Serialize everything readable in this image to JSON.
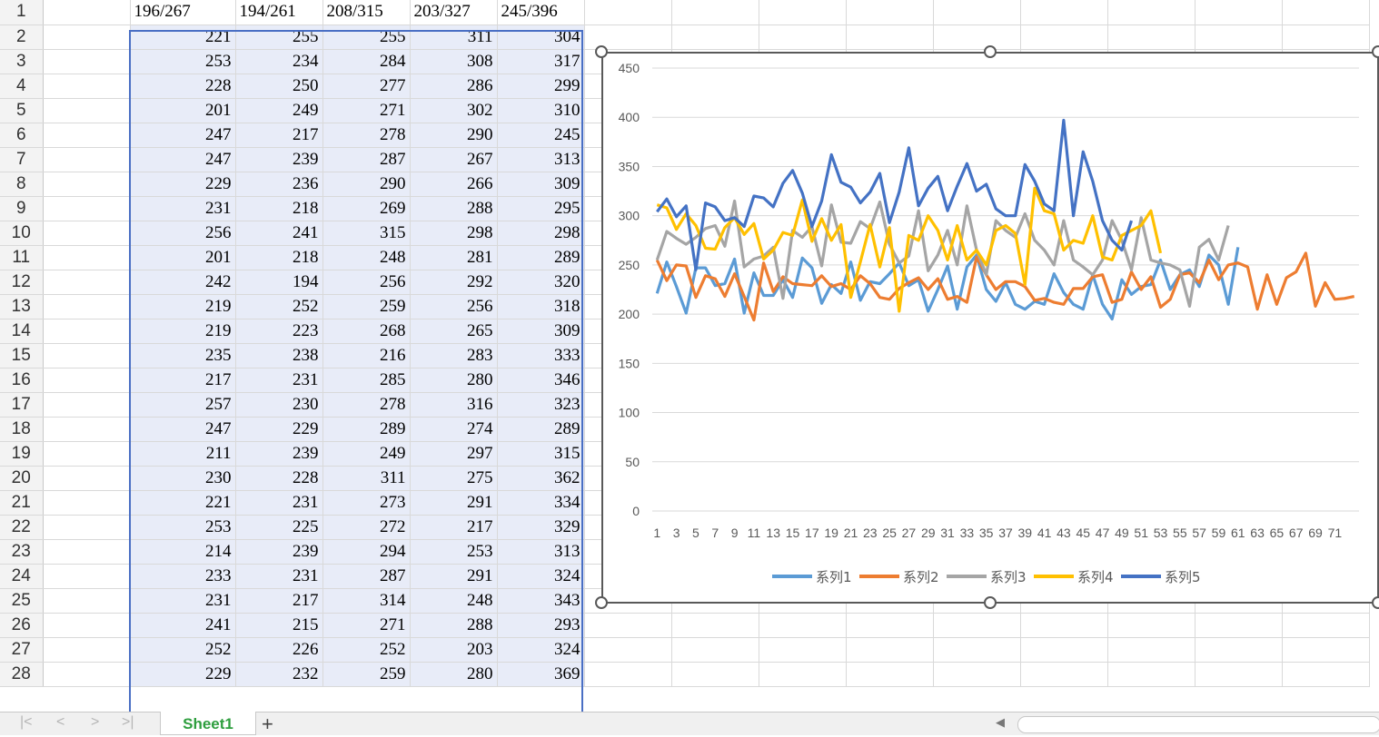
{
  "sheet": {
    "col_headers": [
      "196/267",
      "194/261",
      "208/315",
      "203/327",
      "245/396"
    ],
    "row_numbers": [
      "1",
      "2",
      "3",
      "4",
      "5",
      "6",
      "7",
      "8",
      "9",
      "10",
      "11",
      "12",
      "13",
      "14",
      "15",
      "16",
      "17",
      "18",
      "19",
      "20",
      "21",
      "22",
      "23",
      "24",
      "25",
      "26",
      "27",
      "28"
    ],
    "rows": [
      [
        "221",
        "255",
        "255",
        "311",
        "304"
      ],
      [
        "253",
        "234",
        "284",
        "308",
        "317"
      ],
      [
        "228",
        "250",
        "277",
        "286",
        "299"
      ],
      [
        "201",
        "249",
        "271",
        "302",
        "310"
      ],
      [
        "247",
        "217",
        "278",
        "290",
        "245"
      ],
      [
        "247",
        "239",
        "287",
        "267",
        "313"
      ],
      [
        "229",
        "236",
        "290",
        "266",
        "309"
      ],
      [
        "231",
        "218",
        "269",
        "288",
        "295"
      ],
      [
        "256",
        "241",
        "315",
        "298",
        "298"
      ],
      [
        "201",
        "218",
        "248",
        "281",
        "289"
      ],
      [
        "242",
        "194",
        "256",
        "292",
        "320"
      ],
      [
        "219",
        "252",
        "259",
        "256",
        "318"
      ],
      [
        "219",
        "223",
        "268",
        "265",
        "309"
      ],
      [
        "235",
        "238",
        "216",
        "283",
        "333"
      ],
      [
        "217",
        "231",
        "285",
        "280",
        "346"
      ],
      [
        "257",
        "230",
        "278",
        "316",
        "323"
      ],
      [
        "247",
        "229",
        "289",
        "274",
        "289"
      ],
      [
        "211",
        "239",
        "249",
        "297",
        "315"
      ],
      [
        "230",
        "228",
        "311",
        "275",
        "362"
      ],
      [
        "221",
        "231",
        "273",
        "291",
        "334"
      ],
      [
        "253",
        "225",
        "272",
        "217",
        "329"
      ],
      [
        "214",
        "239",
        "294",
        "253",
        "313"
      ],
      [
        "233",
        "231",
        "287",
        "291",
        "324"
      ],
      [
        "231",
        "217",
        "314",
        "248",
        "343"
      ],
      [
        "241",
        "215",
        "271",
        "288",
        "293"
      ],
      [
        "252",
        "226",
        "252",
        "203",
        "324"
      ],
      [
        "229",
        "232",
        "259",
        "280",
        "369"
      ]
    ]
  },
  "tabs": {
    "sheet1": "Sheet1",
    "add_symbol": "+"
  },
  "colors": {
    "series1": "#5b9bd5",
    "series2": "#ed7d31",
    "series3": "#a5a5a5",
    "series4": "#ffc000",
    "series5": "#4472c4",
    "selection": "#e8ecf8",
    "tab_text": "#2e9e3e"
  },
  "chart_data": {
    "type": "line",
    "ylim": [
      0,
      450
    ],
    "yticks": [
      0,
      50,
      100,
      150,
      200,
      250,
      300,
      350,
      400,
      450
    ],
    "x_tick_labels": [
      "1",
      "3",
      "5",
      "7",
      "9",
      "11",
      "13",
      "15",
      "17",
      "19",
      "21",
      "23",
      "25",
      "27",
      "29",
      "31",
      "33",
      "35",
      "37",
      "39",
      "41",
      "43",
      "45",
      "47",
      "49",
      "51",
      "53",
      "55",
      "57",
      "59",
      "61",
      "63",
      "65",
      "67",
      "69",
      "71"
    ],
    "grid": true,
    "legend_position": "bottom",
    "series": [
      {
        "name": "系列1",
        "values": [
          221,
          253,
          228,
          201,
          247,
          247,
          229,
          231,
          256,
          201,
          242,
          219,
          219,
          235,
          217,
          257,
          247,
          211,
          230,
          221,
          253,
          214,
          233,
          231,
          241,
          252,
          229,
          235,
          203,
          225,
          249,
          205,
          248,
          260,
          225,
          213,
          232,
          210,
          205,
          213,
          210,
          241,
          222,
          210,
          205,
          240,
          210,
          195,
          235,
          220,
          228,
          230,
          255,
          225,
          240,
          245,
          228,
          260,
          250,
          210,
          268
        ]
      },
      {
        "name": "系列2",
        "values": [
          255,
          234,
          250,
          249,
          217,
          239,
          236,
          218,
          241,
          218,
          194,
          252,
          223,
          238,
          231,
          230,
          229,
          239,
          228,
          231,
          225,
          239,
          231,
          217,
          215,
          226,
          232,
          237,
          225,
          236,
          215,
          218,
          212,
          258,
          240,
          225,
          233,
          233,
          228,
          214,
          216,
          212,
          210,
          226,
          226,
          238,
          240,
          212,
          215,
          243,
          225,
          238,
          207,
          215,
          240,
          242,
          232,
          255,
          235,
          250,
          252,
          248,
          205,
          240,
          210,
          237,
          243,
          262,
          208,
          232,
          215,
          216,
          218
        ]
      },
      {
        "name": "系列3",
        "values": [
          255,
          284,
          277,
          271,
          278,
          287,
          290,
          269,
          315,
          248,
          256,
          259,
          268,
          216,
          285,
          278,
          289,
          249,
          311,
          273,
          272,
          294,
          287,
          314,
          271,
          252,
          259,
          305,
          244,
          260,
          285,
          250,
          310,
          265,
          240,
          295,
          285,
          278,
          302,
          275,
          265,
          250,
          295,
          255,
          248,
          240,
          255,
          295,
          275,
          245,
          298,
          255,
          252,
          250,
          245,
          208,
          268,
          276,
          255,
          290
        ]
      },
      {
        "name": "系列4",
        "values": [
          311,
          308,
          286,
          302,
          290,
          267,
          266,
          288,
          298,
          281,
          292,
          256,
          265,
          283,
          280,
          316,
          274,
          297,
          275,
          291,
          217,
          253,
          291,
          248,
          288,
          203,
          280,
          275,
          300,
          285,
          255,
          290,
          255,
          265,
          250,
          285,
          290,
          282,
          230,
          328,
          305,
          302,
          265,
          275,
          272,
          300,
          258,
          255,
          280,
          285,
          290,
          305,
          262
        ]
      },
      {
        "name": "系列5",
        "values": [
          304,
          317,
          299,
          310,
          245,
          313,
          309,
          295,
          298,
          289,
          320,
          318,
          309,
          333,
          346,
          323,
          289,
          315,
          362,
          334,
          329,
          313,
          324,
          343,
          293,
          324,
          369,
          310,
          328,
          340,
          305,
          330,
          353,
          325,
          332,
          307,
          300,
          300,
          352,
          335,
          312,
          305,
          397,
          300,
          365,
          335,
          295,
          275,
          265,
          295
        ]
      }
    ]
  }
}
